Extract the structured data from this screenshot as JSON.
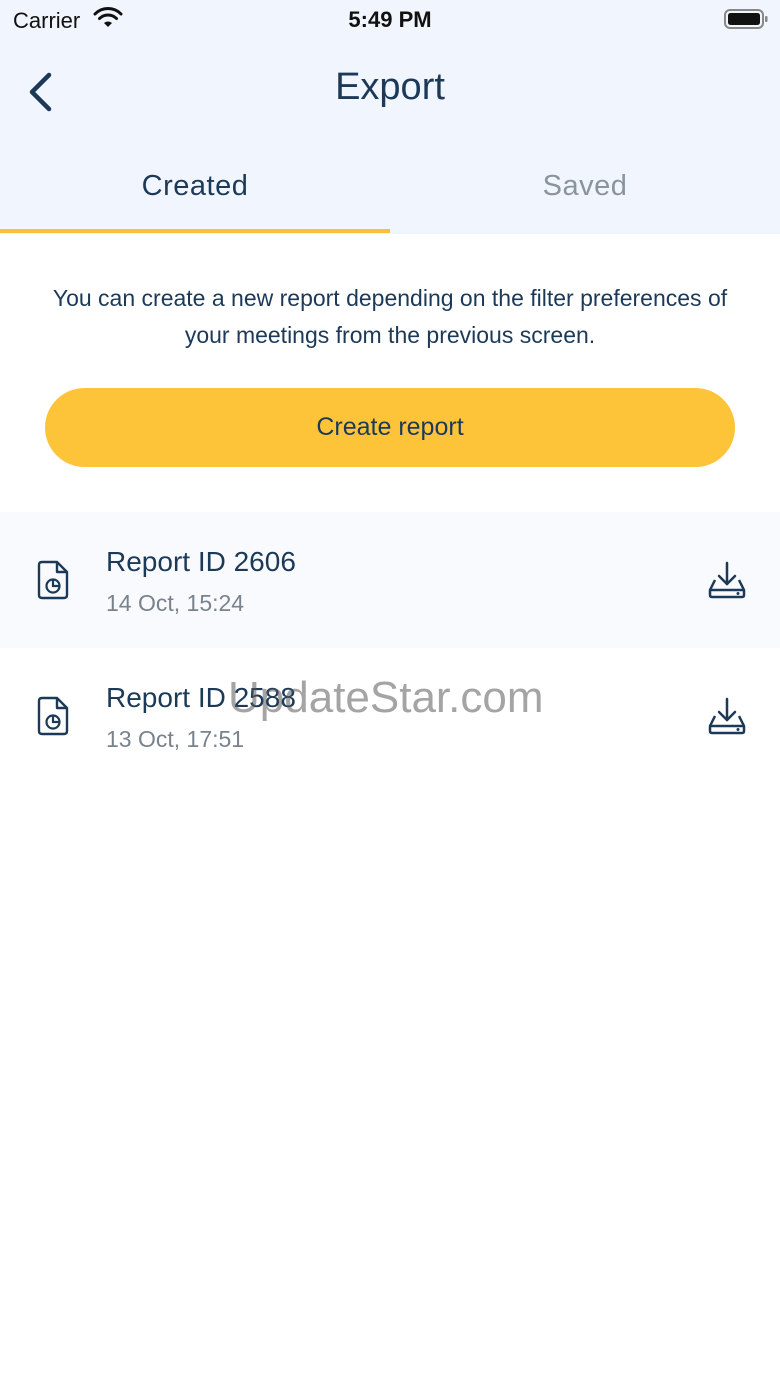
{
  "status_bar": {
    "carrier": "Carrier",
    "time": "5:49 PM"
  },
  "nav": {
    "title": "Export",
    "back_icon": "chevron-left-icon"
  },
  "tabs": [
    {
      "label": "Created",
      "active": true
    },
    {
      "label": "Saved",
      "active": false
    }
  ],
  "info_text": "You can create a new report depending on the filter preferences of your meetings from the previous screen.",
  "create_button": {
    "label": "Create report"
  },
  "reports": [
    {
      "title": "Report ID 2606",
      "date": "14 Oct, 15:24"
    },
    {
      "title": "Report ID 2588",
      "date": "13 Oct, 17:51"
    }
  ],
  "watermark": "UpdateStar.com",
  "colors": {
    "accent": "#fdc43a",
    "header_bg": "#f1f5fd",
    "text_primary": "#1c3a57",
    "text_muted": "#8a949e"
  }
}
